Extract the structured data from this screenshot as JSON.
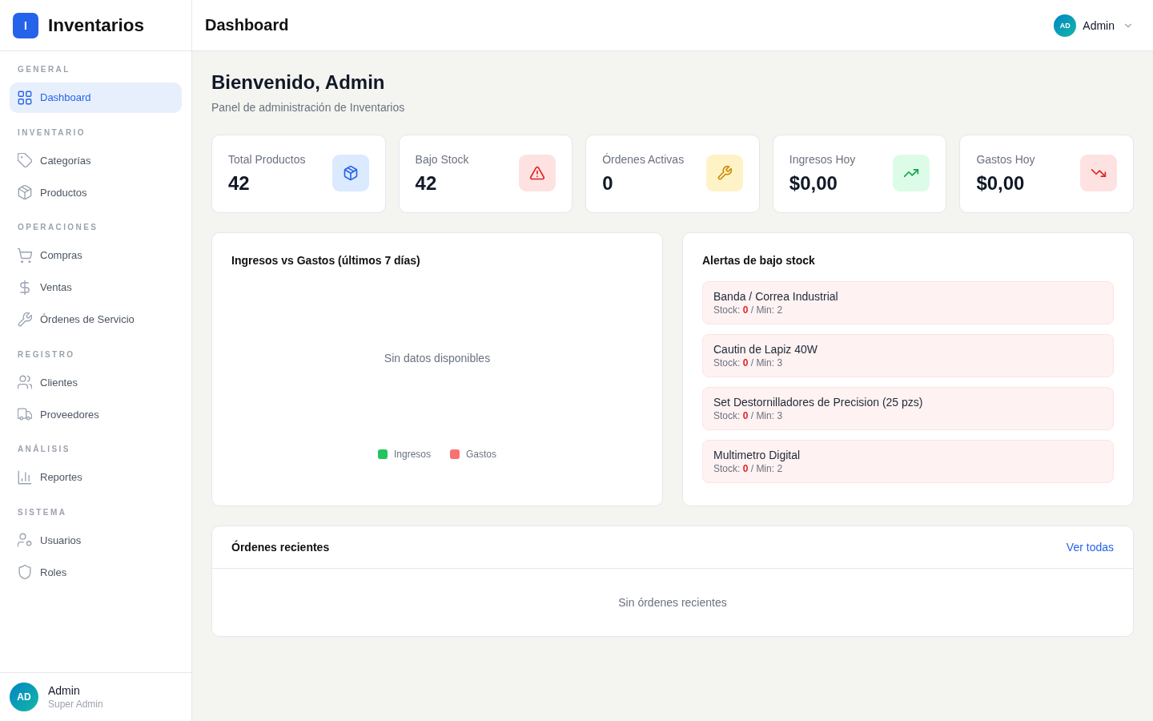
{
  "sidebar": {
    "logo": {
      "mark": "I",
      "title": "Inventarios"
    },
    "sections": [
      {
        "heading": "GENERAL",
        "items": [
          {
            "label": "Dashboard",
            "selected": true
          }
        ]
      },
      {
        "heading": "INVENTARIO",
        "items": [
          {
            "label": "Categorías",
            "selected": false
          },
          {
            "label": "Productos",
            "selected": false
          }
        ]
      },
      {
        "heading": "OPERACIONES",
        "items": [
          {
            "label": "Compras",
            "selected": false
          },
          {
            "label": "Ventas",
            "selected": false
          },
          {
            "label": "Órdenes de Servicio",
            "selected": false
          }
        ]
      },
      {
        "heading": "REGISTRO",
        "items": [
          {
            "label": "Clientes",
            "selected": false
          },
          {
            "label": "Proveedores",
            "selected": false
          }
        ]
      },
      {
        "heading": "ANÁLISIS",
        "items": [
          {
            "label": "Reportes",
            "selected": false
          }
        ]
      },
      {
        "heading": "SISTEMA",
        "items": [
          {
            "label": "Usuarios",
            "selected": false
          },
          {
            "label": "Roles",
            "selected": false
          }
        ]
      }
    ],
    "user": {
      "initials": "AD",
      "name": "Admin",
      "role": "Super Admin"
    }
  },
  "topbar": {
    "title": "Dashboard",
    "user": {
      "initials": "AD",
      "name": "Admin"
    }
  },
  "welcome": {
    "title": "Bienvenido, Admin",
    "subtitle": "Panel de administración de Inventarios"
  },
  "stats": [
    {
      "label": "Total Productos",
      "value": "42",
      "color": "#dbeafe"
    },
    {
      "label": "Bajo Stock",
      "value": "42",
      "color": "#fee2e2"
    },
    {
      "label": "Órdenes Activas",
      "value": "0",
      "color": "#fef3c7"
    },
    {
      "label": "Ingresos Hoy",
      "value": "$0,00",
      "color": "#dcfce7"
    },
    {
      "label": "Gastos Hoy",
      "value": "$0,00",
      "color": "#fee2e2"
    }
  ],
  "chart": {
    "title": "Ingresos vs Gastos (últimos 7 días)",
    "empty_message": "Sin datos disponibles",
    "legend": [
      {
        "label": "Ingresos",
        "color": "#22c55e"
      },
      {
        "label": "Gastos",
        "color": "#f87171"
      }
    ]
  },
  "low_stock": {
    "title": "Alertas de bajo stock",
    "items": [
      {
        "name": "Banda / Correa Industrial",
        "stock": "Stock: **0** / Min: 2"
      },
      {
        "name": "Cautin de Lapiz 40W",
        "stock": "Stock: **0** / Min: 3"
      },
      {
        "name": "Set Destornilladores de Precision (25 pzs)",
        "stock": "Stock: **0** / Min: 3"
      },
      {
        "name": "Multimetro Digital",
        "stock": "Stock: **0** / Min: 2"
      }
    ]
  },
  "recent_orders": {
    "title": "Órdenes recientes",
    "link": "Ver todas",
    "empty_message": "Sin órdenes recientes"
  }
}
